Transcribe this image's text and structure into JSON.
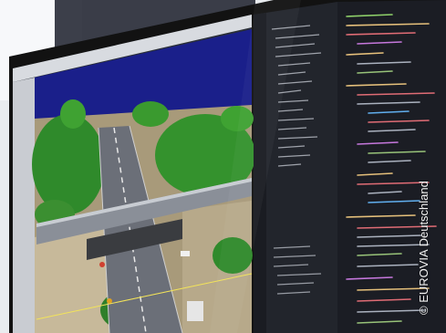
{
  "photo": {
    "subject": "monitor-showing-point-cloud-and-code"
  },
  "credit": {
    "text": "© EUROVIA Deutschland"
  },
  "colors": {
    "wall": "#e9ecef",
    "monitor_bezel": "#151515",
    "point_cloud_sky": "#1a1f8a",
    "code_editor_bg": "#1b1d24",
    "road": "#6b6f78",
    "vegetation": "#2f8a2b"
  }
}
